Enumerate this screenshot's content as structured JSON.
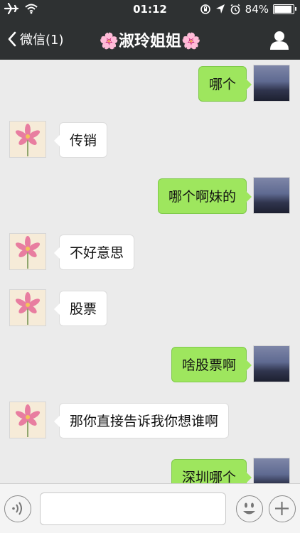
{
  "status_bar": {
    "time": "01:12",
    "battery": "84%",
    "battery_level": 0.84,
    "icons": [
      "airplane-icon",
      "wifi-icon",
      "rotation-lock-icon",
      "location-icon",
      "alarm-icon",
      "battery-icon"
    ]
  },
  "nav": {
    "back_label": "微信(1)",
    "title": "🌸淑玲姐姐🌸",
    "profile_icon": "person-icon"
  },
  "messages": [
    {
      "side": "right",
      "text": "哪个"
    },
    {
      "side": "left",
      "text": "传销"
    },
    {
      "side": "right",
      "text": "哪个啊妹的"
    },
    {
      "side": "left",
      "text": "不好意思"
    },
    {
      "side": "left",
      "text": "股票"
    },
    {
      "side": "right",
      "text": "啥股票啊"
    },
    {
      "side": "left",
      "text": "那你直接告诉我你想谁啊"
    },
    {
      "side": "right",
      "text": "深圳哪个"
    }
  ],
  "input": {
    "value": "",
    "placeholder": ""
  },
  "colors": {
    "bar_bg": "#2e3132",
    "chat_bg": "#ebebeb",
    "sent_bubble": "#9ee65e",
    "received_bubble": "#ffffff"
  }
}
